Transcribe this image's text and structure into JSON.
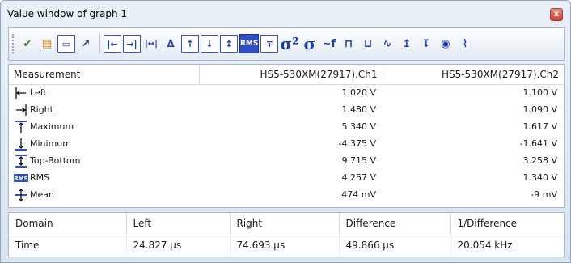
{
  "window": {
    "title": "Value window of graph 1",
    "close_label": "x"
  },
  "toolbar": {
    "buttons": [
      {
        "name": "channel-select-icon",
        "glyph": "✔"
      },
      {
        "name": "clipboard-icon",
        "glyph": "▤"
      },
      {
        "name": "display-icon",
        "glyph": "▭"
      },
      {
        "name": "pin-icon",
        "glyph": "↗"
      },
      {
        "name": "left-cursor-icon",
        "glyph": "|←"
      },
      {
        "name": "right-cursor-icon",
        "glyph": "→|"
      },
      {
        "name": "difference-icon",
        "glyph": "|↔|"
      },
      {
        "name": "rise-time-icon",
        "glyph": "∆"
      },
      {
        "name": "maximum-icon",
        "glyph": "↑"
      },
      {
        "name": "minimum-icon",
        "glyph": "↓"
      },
      {
        "name": "top-bottom-icon",
        "glyph": "↕"
      },
      {
        "name": "rms-icon",
        "glyph": "RMS"
      },
      {
        "name": "mean-icon",
        "glyph": "∓"
      },
      {
        "name": "variance-icon",
        "glyph": "σ²"
      },
      {
        "name": "std-dev-icon",
        "glyph": "σ"
      },
      {
        "name": "frequency-icon",
        "glyph": "∼f"
      },
      {
        "name": "pulse-width-pos-icon",
        "glyph": "⊓"
      },
      {
        "name": "pulse-width-neg-icon",
        "glyph": "⊔"
      },
      {
        "name": "waveform-icon",
        "glyph": "∿"
      },
      {
        "name": "rise-edge-icon",
        "glyph": "↥"
      },
      {
        "name": "fall-edge-icon",
        "glyph": "↧"
      },
      {
        "name": "signal-icon",
        "glyph": "◉"
      },
      {
        "name": "period-icon",
        "glyph": "⌇"
      }
    ]
  },
  "measurements": {
    "headers": [
      "Measurement",
      "HS5-530XM(27917).Ch1",
      "HS5-530XM(27917).Ch2"
    ],
    "rows": [
      {
        "icon": "left-marker-icon",
        "label": "Left",
        "ch1": "1.020 V",
        "ch2": "1.100 V"
      },
      {
        "icon": "right-marker-icon",
        "label": "Right",
        "ch1": "1.480 V",
        "ch2": "1.090 V"
      },
      {
        "icon": "maximum-marker-icon",
        "label": "Maximum",
        "ch1": "5.340 V",
        "ch2": "1.617 V"
      },
      {
        "icon": "minimum-marker-icon",
        "label": "Minimum",
        "ch1": "-4.375 V",
        "ch2": "-1.641 V"
      },
      {
        "icon": "top-bottom-marker-icon",
        "label": "Top-Bottom",
        "ch1": "9.715 V",
        "ch2": "3.258 V"
      },
      {
        "icon": "rms-marker-icon",
        "label": "RMS",
        "ch1": "4.257 V",
        "ch2": "1.340 V"
      },
      {
        "icon": "mean-marker-icon",
        "label": "Mean",
        "ch1": "474 mV",
        "ch2": "-9 mV"
      }
    ]
  },
  "cursors": {
    "headers": [
      "Domain",
      "Left",
      "Right",
      "Difference",
      "1/Difference"
    ],
    "rows": [
      {
        "domain": "Time",
        "left": "24.827 µs",
        "right": "74.693 µs",
        "difference": "49.866 µs",
        "inv_difference": "20.054 kHz"
      }
    ]
  },
  "colors": {
    "accent": "#1f3ea8",
    "close": "#c4402d"
  }
}
